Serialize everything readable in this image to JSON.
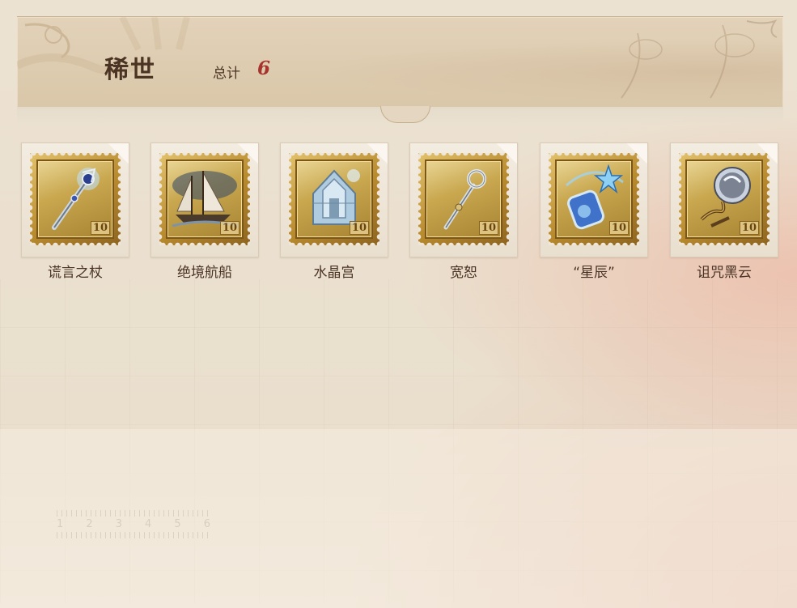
{
  "header": {
    "title": "稀世",
    "total_label": "总计",
    "total_count": "6"
  },
  "ruler": {
    "numbers": [
      "1",
      "2",
      "3",
      "4",
      "5",
      "6"
    ]
  },
  "items": [
    {
      "name": "谎言之杖",
      "stamp_value": "10",
      "icon": "scepter-icon"
    },
    {
      "name": "绝境航船",
      "stamp_value": "10",
      "icon": "ship-icon"
    },
    {
      "name": "水晶宫",
      "stamp_value": "10",
      "icon": "crystal-palace-icon"
    },
    {
      "name": "宽恕",
      "stamp_value": "10",
      "icon": "staff-icon"
    },
    {
      "name": "“星辰”",
      "stamp_value": "10",
      "icon": "star-bottle-icon"
    },
    {
      "name": "诅咒黑云",
      "stamp_value": "10",
      "icon": "dark-orb-icon"
    }
  ],
  "colors": {
    "title": "#4b3424",
    "count": "#a7332d",
    "stamp_gold": "#c79a3c"
  }
}
